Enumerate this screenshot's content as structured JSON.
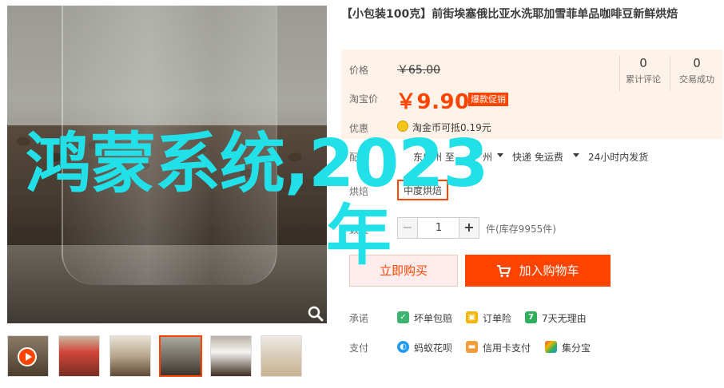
{
  "product": {
    "title": "【小包装100克】前街埃塞俄比亚水洗耶加雪菲单品咖啡豆新鲜烘焙"
  },
  "price_box": {
    "price_label": "价格",
    "original_price": "￥65.00",
    "promo_price_label": "淘宝价",
    "promo_price": "￥9.90",
    "promo_tag": "爆款促销",
    "discount_label": "优惠",
    "coin_text": "淘金币可抵0.19元",
    "reviews_count": "0",
    "reviews_label": "累计评论",
    "sales_count": "0",
    "sales_label": "交易成功"
  },
  "delivery": {
    "label": "配送",
    "from": "东广州 至",
    "to": "广州",
    "fee": "快递 免运费",
    "time": "24小时内发货"
  },
  "spec": {
    "label": "烘焙",
    "selected": "中度烘焙"
  },
  "quantity": {
    "label": "数量",
    "minus": "−",
    "value": "1",
    "plus": "+",
    "stock": "件(库存9955件)"
  },
  "actions": {
    "buy_now": "立即购买",
    "add_to_cart": "加入购物车"
  },
  "promises": {
    "label": "承诺",
    "items": [
      "坏单包赔",
      "订单险",
      "7天无理由"
    ]
  },
  "payment": {
    "label": "支付",
    "items": [
      "蚂蚁花呗",
      "信用卡支付",
      "集分宝"
    ]
  },
  "overlay": {
    "line1": "鸿蒙系统,2023",
    "line2": "年"
  },
  "colors": {
    "accent": "#ff4400",
    "overlay": "#22e0e8"
  },
  "icons": [
    "zoom-icon",
    "play-icon",
    "coin-icon",
    "cart-icon",
    "guarantee-icon",
    "insurance-icon",
    "seven-day-icon",
    "huabei-icon",
    "credit-card-icon",
    "jifenbao-icon"
  ]
}
